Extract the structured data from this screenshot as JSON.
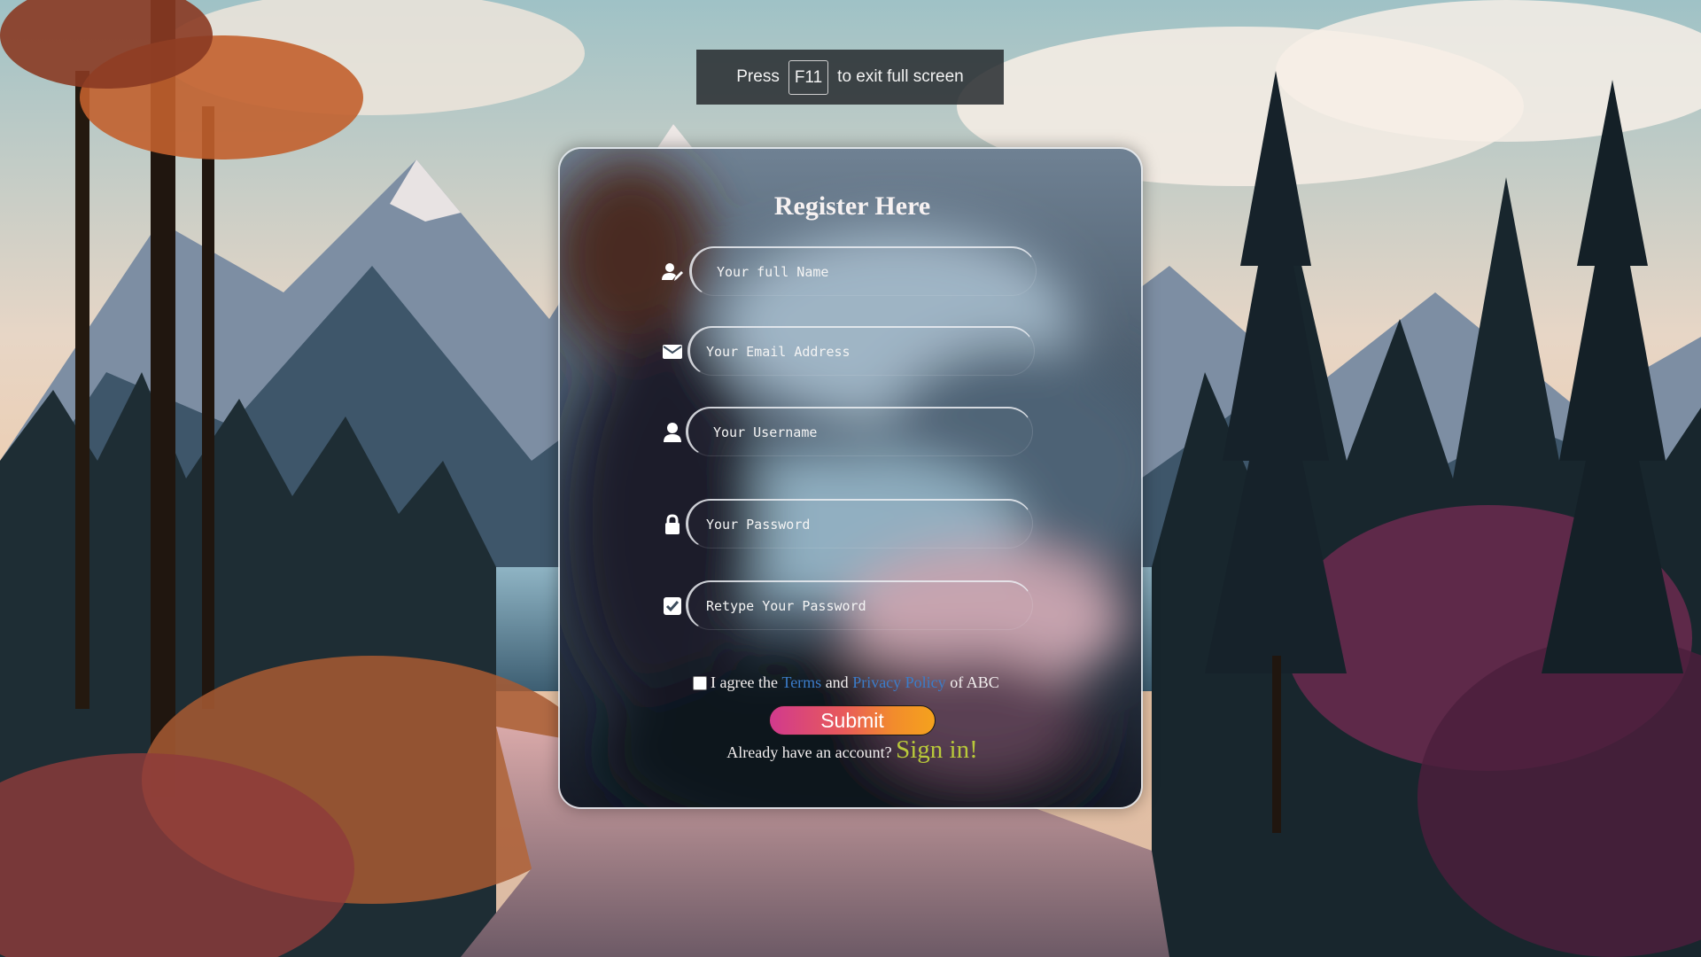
{
  "fullscreen_hint": {
    "prefix": "Press",
    "key": "F11",
    "suffix": "to exit full screen"
  },
  "form": {
    "title": "Register Here",
    "fields": [
      {
        "icon": "user-edit-icon",
        "placeholder": "Your full Name"
      },
      {
        "icon": "envelope-icon",
        "placeholder": "Your Email Address"
      },
      {
        "icon": "user-icon",
        "placeholder": "Your Username"
      },
      {
        "icon": "lock-icon",
        "placeholder": "Your Password"
      },
      {
        "icon": "check-square-icon",
        "placeholder": "Retype Your Password"
      }
    ],
    "agree": {
      "prefix": "I agree the",
      "terms": "Terms",
      "and": "and",
      "privacy": "Privacy Policy",
      "suffix": "of ABC",
      "checked": false
    },
    "submit_label": "Submit",
    "signin": {
      "prompt": "Already have an account?",
      "link": "Sign in!"
    }
  },
  "colors": {
    "link": "#3b7cc9",
    "signin": "#b9c93a",
    "submit_gradient": [
      "#d13a8d",
      "#f5a21d"
    ]
  }
}
